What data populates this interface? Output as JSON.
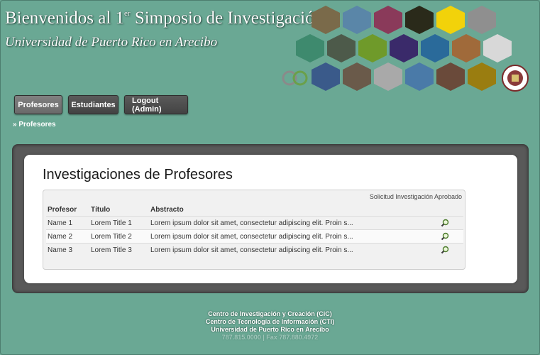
{
  "header": {
    "title_main": "Bienvenidos al 1",
    "title_sup": "er",
    "title_rest": " Simposio de Investigación",
    "subtitle": "Universidad de Puerto Rico en Arecibo",
    "logo_text": "CiC"
  },
  "nav": {
    "items": [
      {
        "label": "Profesores"
      },
      {
        "label": "Estudiantes"
      },
      {
        "label": "Logout (Admin)"
      }
    ]
  },
  "breadcrumb": "» Profesores",
  "main": {
    "title": "Investigaciones de Profesores",
    "table": {
      "caption": "Solicitud Investigación Aprobado",
      "columns": [
        "Profesor",
        "Título",
        "Abstracto"
      ],
      "rows": [
        {
          "profesor": "Name 1",
          "titulo": "Lorem Title 1",
          "abstracto": "Lorem ipsum dolor sit amet, consectetur adipiscing elit. Proin s..."
        },
        {
          "profesor": "Name 2",
          "titulo": "Lorem Title 2",
          "abstracto": "Lorem ipsum dolor sit amet, consectetur adipiscing elit. Proin s..."
        },
        {
          "profesor": "Name 3",
          "titulo": "Lorem Title 3",
          "abstracto": "Lorem ipsum dolor sit amet, consectetur adipiscing elit. Proin s..."
        }
      ]
    }
  },
  "footer": {
    "line1": "Centro de Investigación y Creación (CiC)",
    "line2": "Centro de Tecnología de Información (CTI)",
    "line3": "Universidad de Puerto Rico en Arecibo",
    "line4": "787.815.0000 | Fax 787.880.4972"
  },
  "colors": {
    "background": "#6aa894",
    "panel": "#595959",
    "hex_yellow": "#f2d20a",
    "hex_olive": "#9a7d10",
    "hex_green": "#3e8a6e"
  }
}
